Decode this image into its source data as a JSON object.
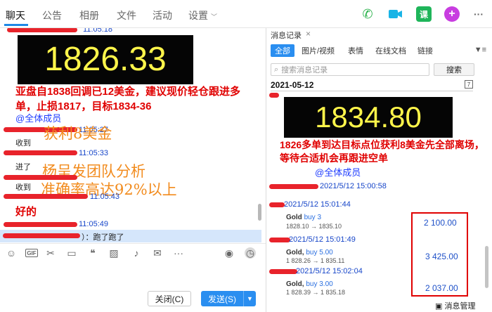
{
  "nav": {
    "tabs": [
      "聊天",
      "公告",
      "相册",
      "文件",
      "活动",
      "设置"
    ]
  },
  "chat": {
    "top_time": "11:05:18",
    "price_big": "1826.33",
    "red_message": "亚盘自1838回调已12美金，建议现价轻仓跟进多单，止损1817，目标1834-36",
    "mention": "@全体成员",
    "overlay_1": "获利8美金",
    "overlay_2": "杨呈发团队分析",
    "overlay_3": "准确率高达92%以上",
    "time_1": "11:05:27",
    "msg_1": "收到",
    "time_2": "11:05:33",
    "msg_2": "进了",
    "time_3": "11:05:43",
    "msg_3": "收到",
    "msg_4": "好的",
    "time_4": "11:05:49",
    "reply_text": "）：跑了跑了",
    "close_button": "关闭(C)",
    "send_button": "发送(S)"
  },
  "history": {
    "tab_title": "消息记录",
    "filters": [
      "全部",
      "图片/视频",
      "表情",
      "在线文档",
      "链接"
    ],
    "search_placeholder": "搜索消息记录",
    "search_button": "搜索",
    "date": "2021-05-12",
    "price_big": "1834.80",
    "red_message": "1826多单到达目标点位获利8美金先全部离场，等待合适机会再跟进空单",
    "mention": "@全体成员",
    "entries": [
      {
        "time": "2021/5/12 15:00:58"
      },
      {
        "time": "2021/5/12 15:01:44",
        "title": "Gold",
        "buy": "buy 3",
        "sub": "1828.10 → 1835.10",
        "amount": "2 100.00"
      },
      {
        "time": "2021/5/12 15:01:49",
        "title": "Gold,",
        "buy": "buy 5.00",
        "sub": "1 828.26 → 1 835.11",
        "amount": "3 425.00"
      },
      {
        "time": "2021/5/12 15:02:04",
        "title": "Gold,",
        "buy": "buy 3.00",
        "sub": "1 828.39 → 1 835.18",
        "amount": "2 037.00"
      }
    ],
    "message_manager": "消息管理"
  }
}
